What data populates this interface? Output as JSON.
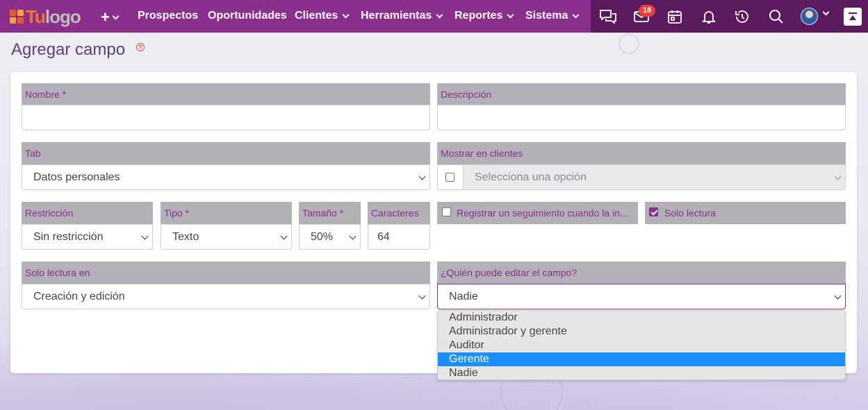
{
  "nav": {
    "logo_tu": "Tu",
    "logo_rest": "logo",
    "items": [
      {
        "label": "Prospectos"
      },
      {
        "label": "Oportunidades"
      },
      {
        "label": "Clientes"
      },
      {
        "label": "Herramientas"
      },
      {
        "label": "Reportes"
      },
      {
        "label": "Sistema"
      }
    ],
    "mail_badge": "18",
    "icons": [
      "plus-icon",
      "chat-icon",
      "mail-icon",
      "calendar-icon",
      "bell-icon",
      "history-icon",
      "search-icon",
      "avatar",
      "scroll-top-icon"
    ]
  },
  "page": {
    "title": "Agregar campo",
    "help_glyph": "?"
  },
  "form": {
    "nombre": {
      "label": "Nombre *",
      "value": ""
    },
    "descripcion": {
      "label": "Descripción",
      "value": ""
    },
    "tab": {
      "label": "Tab",
      "value": "Datos personales"
    },
    "mostrar": {
      "label": "Mostrar en clientes",
      "placeholder": "Selecciona una opción",
      "checked": false
    },
    "restriccion": {
      "label": "Restricción",
      "value": "Sin restricción"
    },
    "tipo": {
      "label": "Tipo *",
      "value": "Texto"
    },
    "tamano": {
      "label": "Tamaño *",
      "value": "50%"
    },
    "caracteres": {
      "label": "Caracteres",
      "value": "64"
    },
    "seguimiento": {
      "label": "Registrar un seguimiento cuando la in...",
      "checked": false
    },
    "solo_lectura": {
      "label": "Solo lectura",
      "checked": true
    },
    "solo_lectura_en": {
      "label": "Solo lectura en",
      "value": "Creación y edición"
    },
    "quien_edita": {
      "label": "¿Quién puede editar el campo?",
      "value": "Nadie"
    }
  },
  "dropdown": {
    "options": [
      "Administrador",
      "Administrador y gerente",
      "Auditor",
      "Gerente",
      "Nadie"
    ],
    "highlighted": "Gerente"
  },
  "colors": {
    "nav_bg": "#8a2f8c",
    "nav_right_bg": "#5a1a5c",
    "label_bg": "#b3b1b7",
    "label_text": "#8a2f8c",
    "highlight": "#1e8fff"
  }
}
